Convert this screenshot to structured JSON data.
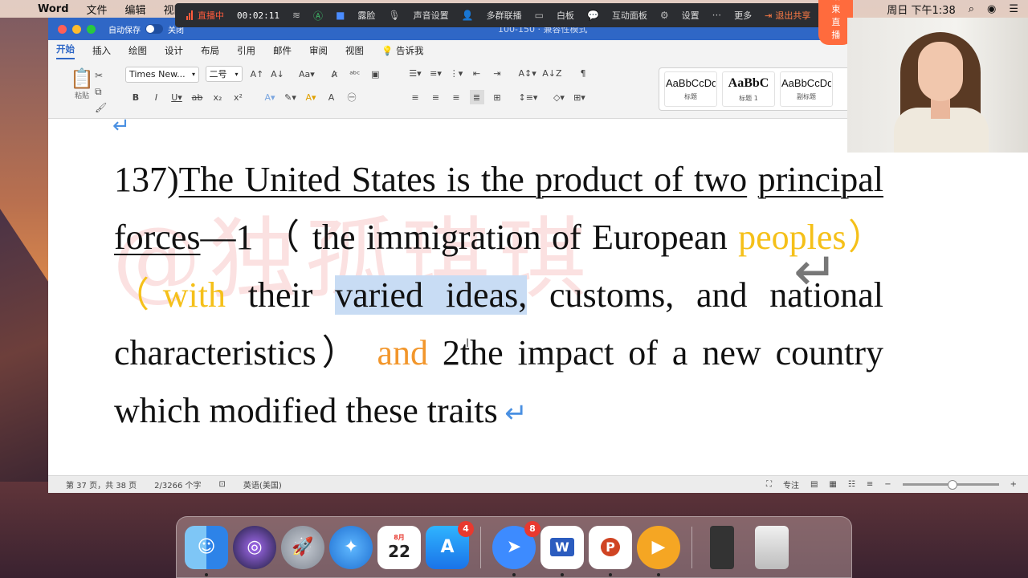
{
  "menubar": {
    "apple": "",
    "app": "Word",
    "items": [
      "文件",
      "编辑",
      "视图"
    ],
    "clock": "周日 下午1:38"
  },
  "livebar": {
    "status": "直播中",
    "elapsed": "00:02:11",
    "buttons": [
      "露脸",
      "声音设置",
      "多群联播",
      "白板",
      "互动面板",
      "设置",
      "更多"
    ],
    "exit_share": "退出共享",
    "end_live": "结束直播"
  },
  "window": {
    "autosave_label": "自动保存",
    "autosave_state": "关闭",
    "title": "100-150 · 兼容性模式"
  },
  "ribbon": {
    "tabs": [
      "开始",
      "插入",
      "绘图",
      "设计",
      "布局",
      "引用",
      "邮件",
      "审阅",
      "视图"
    ],
    "tell_me": "告诉我",
    "paste_label": "粘贴",
    "font_name": "Times New...",
    "font_size": "二号",
    "styles": [
      {
        "sample": "AaBbCcDd",
        "name": "标题"
      },
      {
        "sample": "AaBbC",
        "name": "标题 1"
      },
      {
        "sample": "AaBbCcDd",
        "name": "副标题"
      }
    ]
  },
  "document": {
    "watermark": "@独孤琪琪",
    "para_top_mark": "↵",
    "text": {
      "num": "137)",
      "u1": "The United States is the product of two",
      "u2": "principal forces",
      "t1": "—1 （ the immigration of European ",
      "y1": "peoples）（with",
      "t2": " their ",
      "hl": "varied ideas,",
      "t3": " customs, and national characteristics） ",
      "o1": "and",
      "t4": " 2the impact of a new country which modified these traits",
      "ret": " ↵"
    },
    "overlay_return": "↵",
    "cursor": "I"
  },
  "status": {
    "page": "第 37 页，共 38 页",
    "words": "2/3266 个字",
    "language": "英语(美国)",
    "focus": "专注",
    "zoom_minus": "−",
    "zoom_plus": "+"
  },
  "dock": {
    "calendar_month": "8月",
    "calendar_day": "22",
    "appstore_badge": "4",
    "dingtalk_badge": "8"
  }
}
